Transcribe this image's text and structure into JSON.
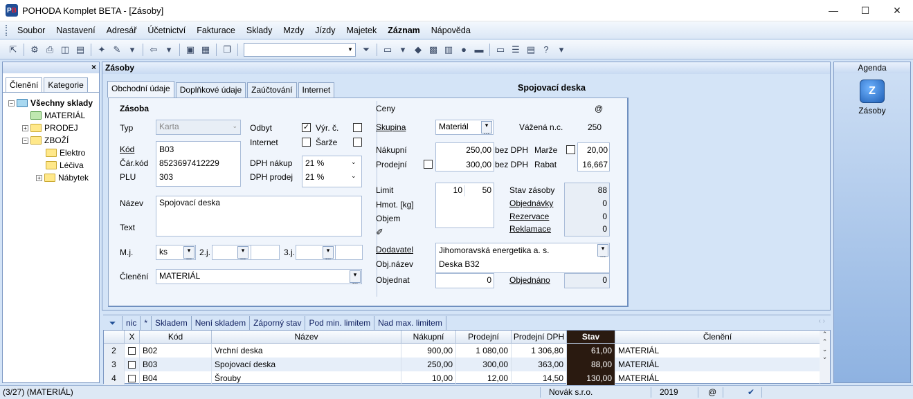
{
  "window": {
    "title": "POHODA Komplet BETA - [Zásoby]",
    "min": "—",
    "max": "☐",
    "close": "✕"
  },
  "menu": [
    "Soubor",
    "Nastavení",
    "Adresář",
    "Účetnictví",
    "Fakturace",
    "Sklady",
    "Mzdy",
    "Jízdy",
    "Majetek",
    "Záznam",
    "Nápověda"
  ],
  "left_panel": {
    "close": "×",
    "tabs": [
      "Členění",
      "Kategorie"
    ],
    "tree": {
      "root": "Všechny sklady",
      "items": [
        "MATERIÁL",
        "PRODEJ",
        "ZBOŽÍ",
        "Elektro",
        "Léčiva",
        "Nábytek"
      ]
    }
  },
  "main": {
    "header": "Zásoby",
    "tabs": [
      "Obchodní údaje",
      "Doplňkové údaje",
      "Zaúčtování",
      "Internet"
    ],
    "record_title": "Spojovací deska",
    "left": {
      "section": "Zásoba",
      "typ_label": "Typ",
      "typ_value": "Karta",
      "kod_label": "Kód",
      "kod_value": "B03",
      "carkod_label": "Čár.kód",
      "carkod_value": "8523697412229",
      "plu_label": "PLU",
      "plu_value": "303",
      "odbyt_label": "Odbyt",
      "internet_label": "Internet",
      "vyrc_label": "Výr. č.",
      "sarze_label": "Šarže",
      "dph_nakup_label": "DPH nákup",
      "dph_nakup_value": "21 %",
      "dph_prodej_label": "DPH prodej",
      "dph_prodej_value": "21 %",
      "nazev_label": "Název",
      "nazev_value": "Spojovací deska",
      "text_label": "Text",
      "mj_label": "M.j.",
      "mj_value": "ks",
      "j2_label": "2.j.",
      "j3_label": "3.j.",
      "cleneni_label": "Členění",
      "cleneni_value": "MATERIÁL"
    },
    "right": {
      "ceny_label": "Ceny",
      "at": "@",
      "skupina_label": "Skupina",
      "skupina_value": "Materiál",
      "vazena_label": "Vážená n.c.",
      "vazena_value": "250",
      "nakupni_label": "Nákupní",
      "nakupni_value": "250,00",
      "bez_dph_1": "bez DPH",
      "marze_label": "Marže",
      "marze_value": "20,00",
      "prodejni_label": "Prodejní",
      "prodejni_value": "300,00",
      "bez_dph_2": "bez DPH",
      "rabat_label": "Rabat",
      "rabat_value": "16,667",
      "limit_label": "Limit",
      "limit_min": "10",
      "limit_max": "50",
      "hmot_label": "Hmot. [kg]",
      "objem_label": "Objem",
      "stav_label": "Stav zásoby",
      "stav_value": "88",
      "objednavky_label": "Objednávky",
      "objednavky_value": "0",
      "rezervace_label": "Rezervace",
      "rezervace_value": "0",
      "reklamace_label": "Reklamace",
      "reklamace_value": "0",
      "dodavatel_label": "Dodavatel",
      "dodavatel_value": "Jihomoravská energetika a. s.",
      "objnazev_label": "Obj.název",
      "objnazev_value": "Deska B32",
      "objednat_label": "Objednat",
      "objednat_value": "0",
      "objednano_label": "Objednáno",
      "objednano_value": "0"
    }
  },
  "filters": [
    "nic",
    "*",
    "Skladem",
    "Není skladem",
    "Záporný stav",
    "Pod min. limitem",
    "Nad max. limitem"
  ],
  "table": {
    "headers": [
      "X",
      "Kód",
      "Název",
      "Nákupní",
      "Prodejní",
      "Prodejní DPH",
      "Stav zásoby",
      "Členění"
    ],
    "rows": [
      {
        "n": "2",
        "kod": "B02",
        "nazev": "Vrchní deska",
        "nakupni": "900,00",
        "prodejni": "1 080,00",
        "prodejni_dph": "1 306,80",
        "stav": "61,00",
        "cleneni": "MATERIÁL"
      },
      {
        "n": "3",
        "kod": "B03",
        "nazev": "Spojovací deska",
        "nakupni": "250,00",
        "prodejni": "300,00",
        "prodejni_dph": "363,00",
        "stav": "88,00",
        "cleneni": "MATERIÁL"
      },
      {
        "n": "4",
        "kod": "B04",
        "nazev": "Šrouby",
        "nakupni": "10,00",
        "prodejni": "12,00",
        "prodejni_dph": "14,50",
        "stav": "130,00",
        "cleneni": "MATERIÁL"
      }
    ]
  },
  "right_panel": {
    "header": "Agenda",
    "item": "Zásoby"
  },
  "status": {
    "left": "(3/27) (MATERIÁL)",
    "company": "Novák s.r.o.",
    "year": "2019",
    "at": "@"
  }
}
